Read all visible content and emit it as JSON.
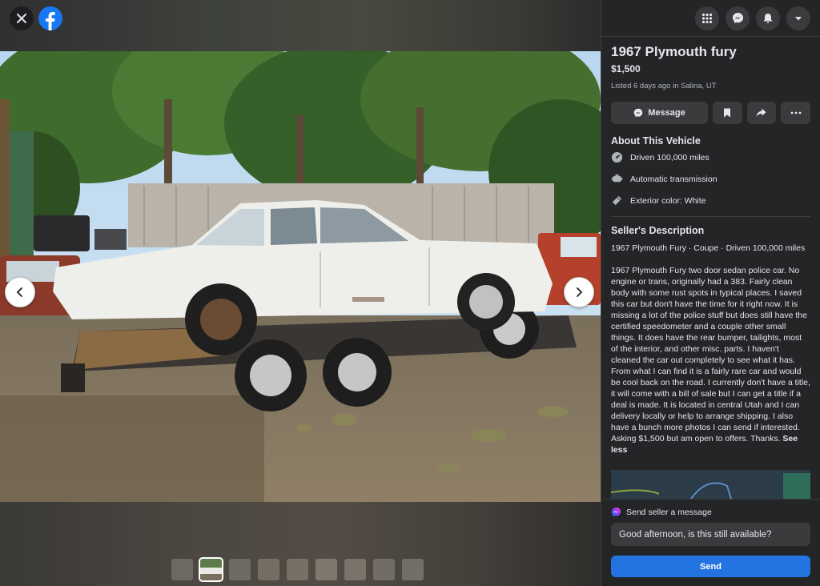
{
  "header": {
    "icons": [
      "close-icon",
      "facebook-logo",
      "menu-grid-icon",
      "messenger-icon",
      "notifications-bell-icon",
      "account-caret-icon"
    ]
  },
  "listing": {
    "title": "1967 Plymouth fury",
    "price": "$1,500",
    "listed": "Listed 6 days ago in Salina, UT"
  },
  "actions": {
    "message_label": "Message",
    "icons": [
      "save-icon",
      "share-icon",
      "more-icon"
    ]
  },
  "about": {
    "heading": "About This Vehicle",
    "features": [
      {
        "icon": "odometer-icon",
        "label": "Driven 100,000 miles"
      },
      {
        "icon": "transmission-icon",
        "label": "Automatic transmission"
      },
      {
        "icon": "paint-icon",
        "label": "Exterior color: White"
      }
    ]
  },
  "description": {
    "heading": "Seller's Description",
    "summary": "1967 Plymouth Fury · Coupe · Driven 100,000 miles",
    "text": "1967 Plymouth Fury two door sedan police car. No engine or trans, originally had a 383. Fairly clean body with some rust spots in typical places. I saved this car but don't have the time for it right now. It is missing a lot of the police stuff but does still have the certified speedometer and a couple other small things. It does have the rear bumper, tailights, most of the interior, and other misc. parts. I haven't cleaned the car out completely to see what it has. From what I can find it is a fairly rare car and would be cool back on the road. I currently don't have a title, it will come with a bill of sale but I can get a title if a deal is made. It is located in central Utah and I can delivery locally or help to arrange shipping. I also have a bunch more photos I can send if interested. Asking $1,500 but am open to offers. Thanks.",
    "see_less": "See less"
  },
  "contact": {
    "heading": "Send seller a message",
    "message_value": "Good afternoon, is this still available?",
    "send_label": "Send"
  },
  "gallery": {
    "thumbnail_count": 9,
    "active_index": 1
  },
  "colors": {
    "panel_bg": "#242526",
    "button_bg": "#3a3b3c",
    "accent": "#2374e1",
    "facebook_blue": "#1877f2"
  }
}
